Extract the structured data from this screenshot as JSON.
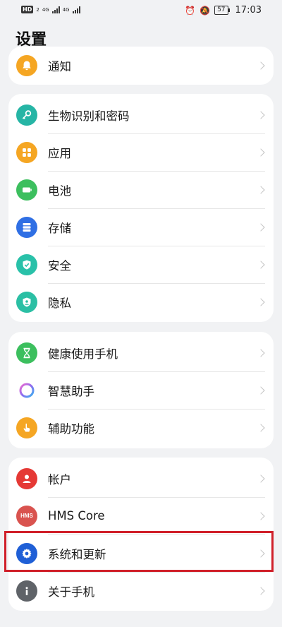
{
  "status_bar": {
    "hd_badge": "HD",
    "sim_number": "2",
    "signal_1_label": "4G",
    "signal_2_label": "4G",
    "battery": "57",
    "time": "17:03",
    "icons": [
      "alarm-icon",
      "mute-icon",
      "battery-icon"
    ]
  },
  "header": {
    "title": "设置"
  },
  "groups": [
    {
      "items": [
        {
          "label": "通知",
          "icon": "bell-icon",
          "color": "#f5a623"
        }
      ]
    },
    {
      "items": [
        {
          "label": "生物识别和密码",
          "icon": "key-icon",
          "color": "#26b5a5"
        },
        {
          "label": "应用",
          "icon": "apps-grid-icon",
          "color": "#f5a623"
        },
        {
          "label": "电池",
          "icon": "battery-icon",
          "color": "#3cbf5e"
        },
        {
          "label": "存储",
          "icon": "storage-icon",
          "color": "#2f6fe4"
        },
        {
          "label": "安全",
          "icon": "shield-check-icon",
          "color": "#29c1a9"
        },
        {
          "label": "隐私",
          "icon": "privacy-shield-icon",
          "color": "#2bbfa4"
        }
      ]
    },
    {
      "items": [
        {
          "label": "健康使用手机",
          "icon": "hourglass-icon",
          "color": "#3cbf5e"
        },
        {
          "label": "智慧助手",
          "icon": "assistant-ring-icon",
          "color": "#b36df0"
        },
        {
          "label": "辅助功能",
          "icon": "hand-icon",
          "color": "#f5a623"
        }
      ]
    },
    {
      "items": [
        {
          "label": "帐户",
          "icon": "user-icon",
          "color": "#e53935"
        },
        {
          "label": "HMS Core",
          "icon": "hms-icon",
          "icon_text": "HMS",
          "color": "#d9534f"
        },
        {
          "label": "系统和更新",
          "icon": "gear-icon",
          "color": "#1f5fd6"
        },
        {
          "label": "关于手机",
          "icon": "info-icon",
          "color": "#5f6368"
        }
      ]
    }
  ],
  "highlight_color": "#d0202a"
}
